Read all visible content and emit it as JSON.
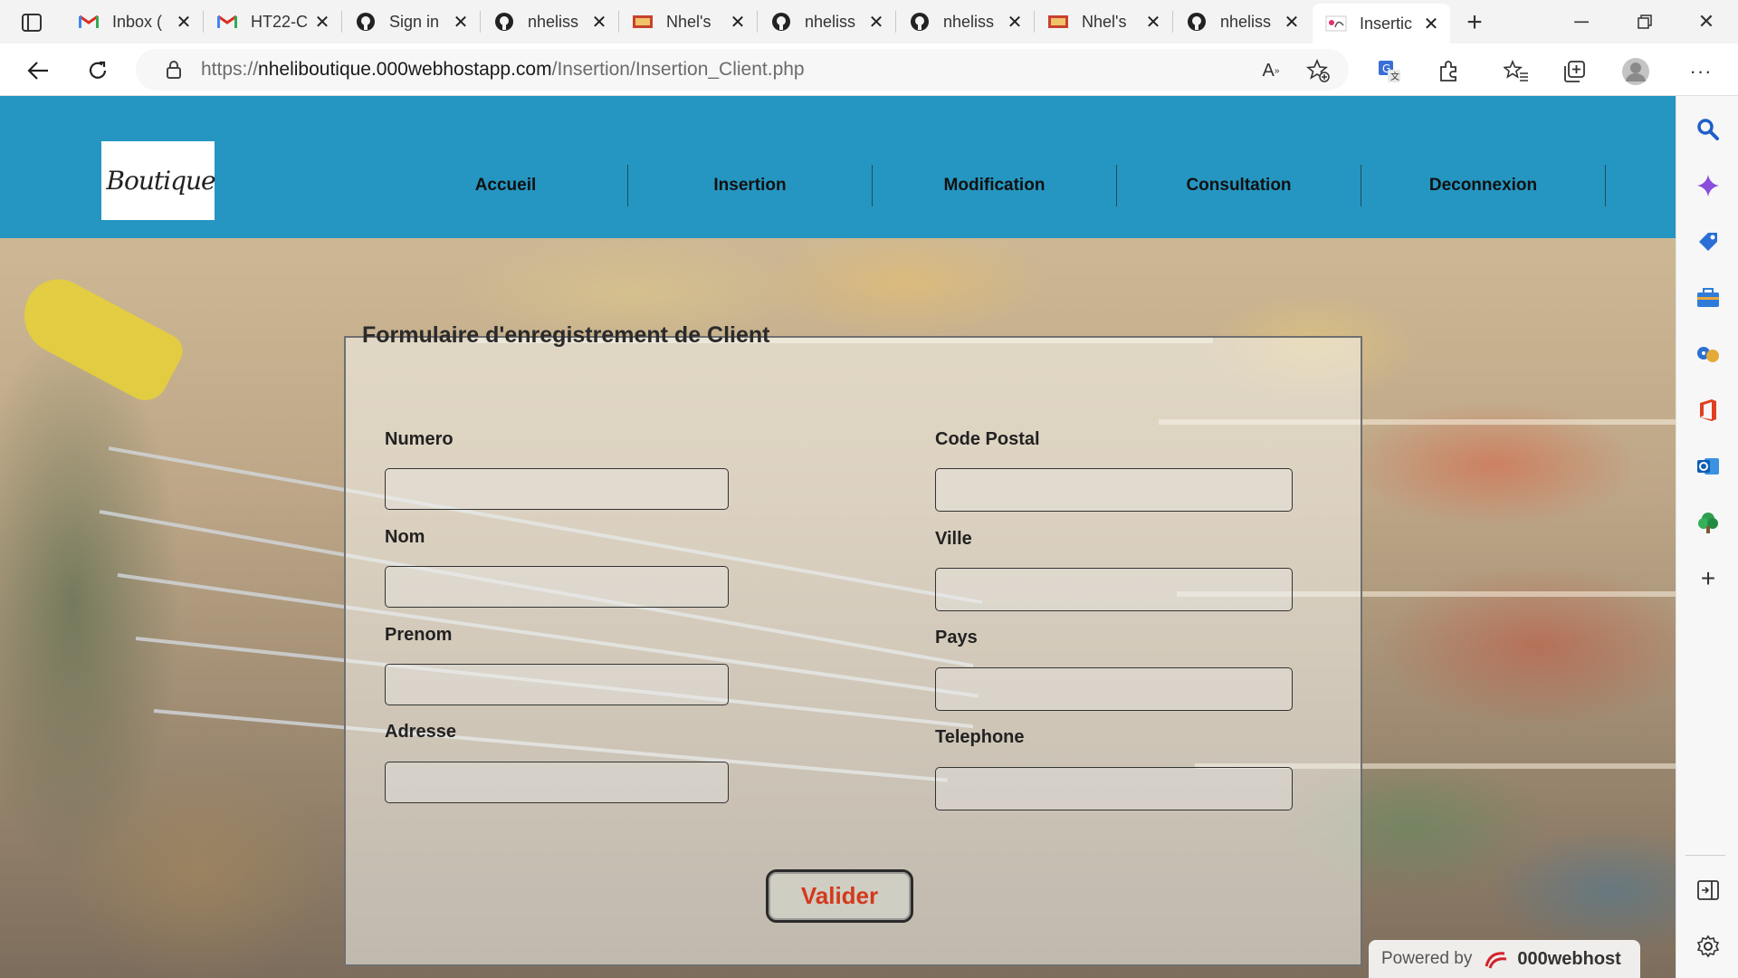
{
  "browser": {
    "tabs": [
      {
        "title": "Inbox (",
        "favicon": "gmail-icon",
        "active": false
      },
      {
        "title": "HT22-C",
        "favicon": "gmail-icon",
        "active": false
      },
      {
        "title": "Sign in",
        "favicon": "github-icon",
        "active": false
      },
      {
        "title": "nheliss",
        "favicon": "github-icon",
        "active": false
      },
      {
        "title": "Nhel's",
        "favicon": "boutique-favicon-icon",
        "active": false
      },
      {
        "title": "nheliss",
        "favicon": "github-icon",
        "active": false
      },
      {
        "title": "nheliss",
        "favicon": "github-icon",
        "active": false
      },
      {
        "title": "Nhel's",
        "favicon": "boutique-favicon-icon",
        "active": false
      },
      {
        "title": "nheliss",
        "favicon": "github-icon",
        "active": false
      },
      {
        "title": "Insertic",
        "favicon": "boutique-favicon-icon",
        "active": true
      }
    ],
    "address": {
      "scheme": "https://",
      "host": "nheliboutique.000webhostapp.com",
      "path": "/Insertion/Insertion_Client.php"
    }
  },
  "site": {
    "logo_text": "Boutique",
    "menu": [
      "Accueil",
      "Insertion",
      "Modification",
      "Consultation",
      "Deconnexion"
    ]
  },
  "form": {
    "legend": "Formulaire d'enregistrement de Client",
    "left_fields": [
      {
        "label": "Numero",
        "value": ""
      },
      {
        "label": "Nom",
        "value": ""
      },
      {
        "label": "Prenom",
        "value": ""
      },
      {
        "label": "Adresse",
        "value": ""
      }
    ],
    "right_fields": [
      {
        "label": "Code Postal",
        "value": ""
      },
      {
        "label": "Ville",
        "value": ""
      },
      {
        "label": "Pays",
        "value": ""
      },
      {
        "label": "Telephone",
        "value": ""
      }
    ],
    "submit_label": "Valider"
  },
  "footer": {
    "powered_prefix": "Powered by",
    "powered_brand": "000webhost"
  }
}
